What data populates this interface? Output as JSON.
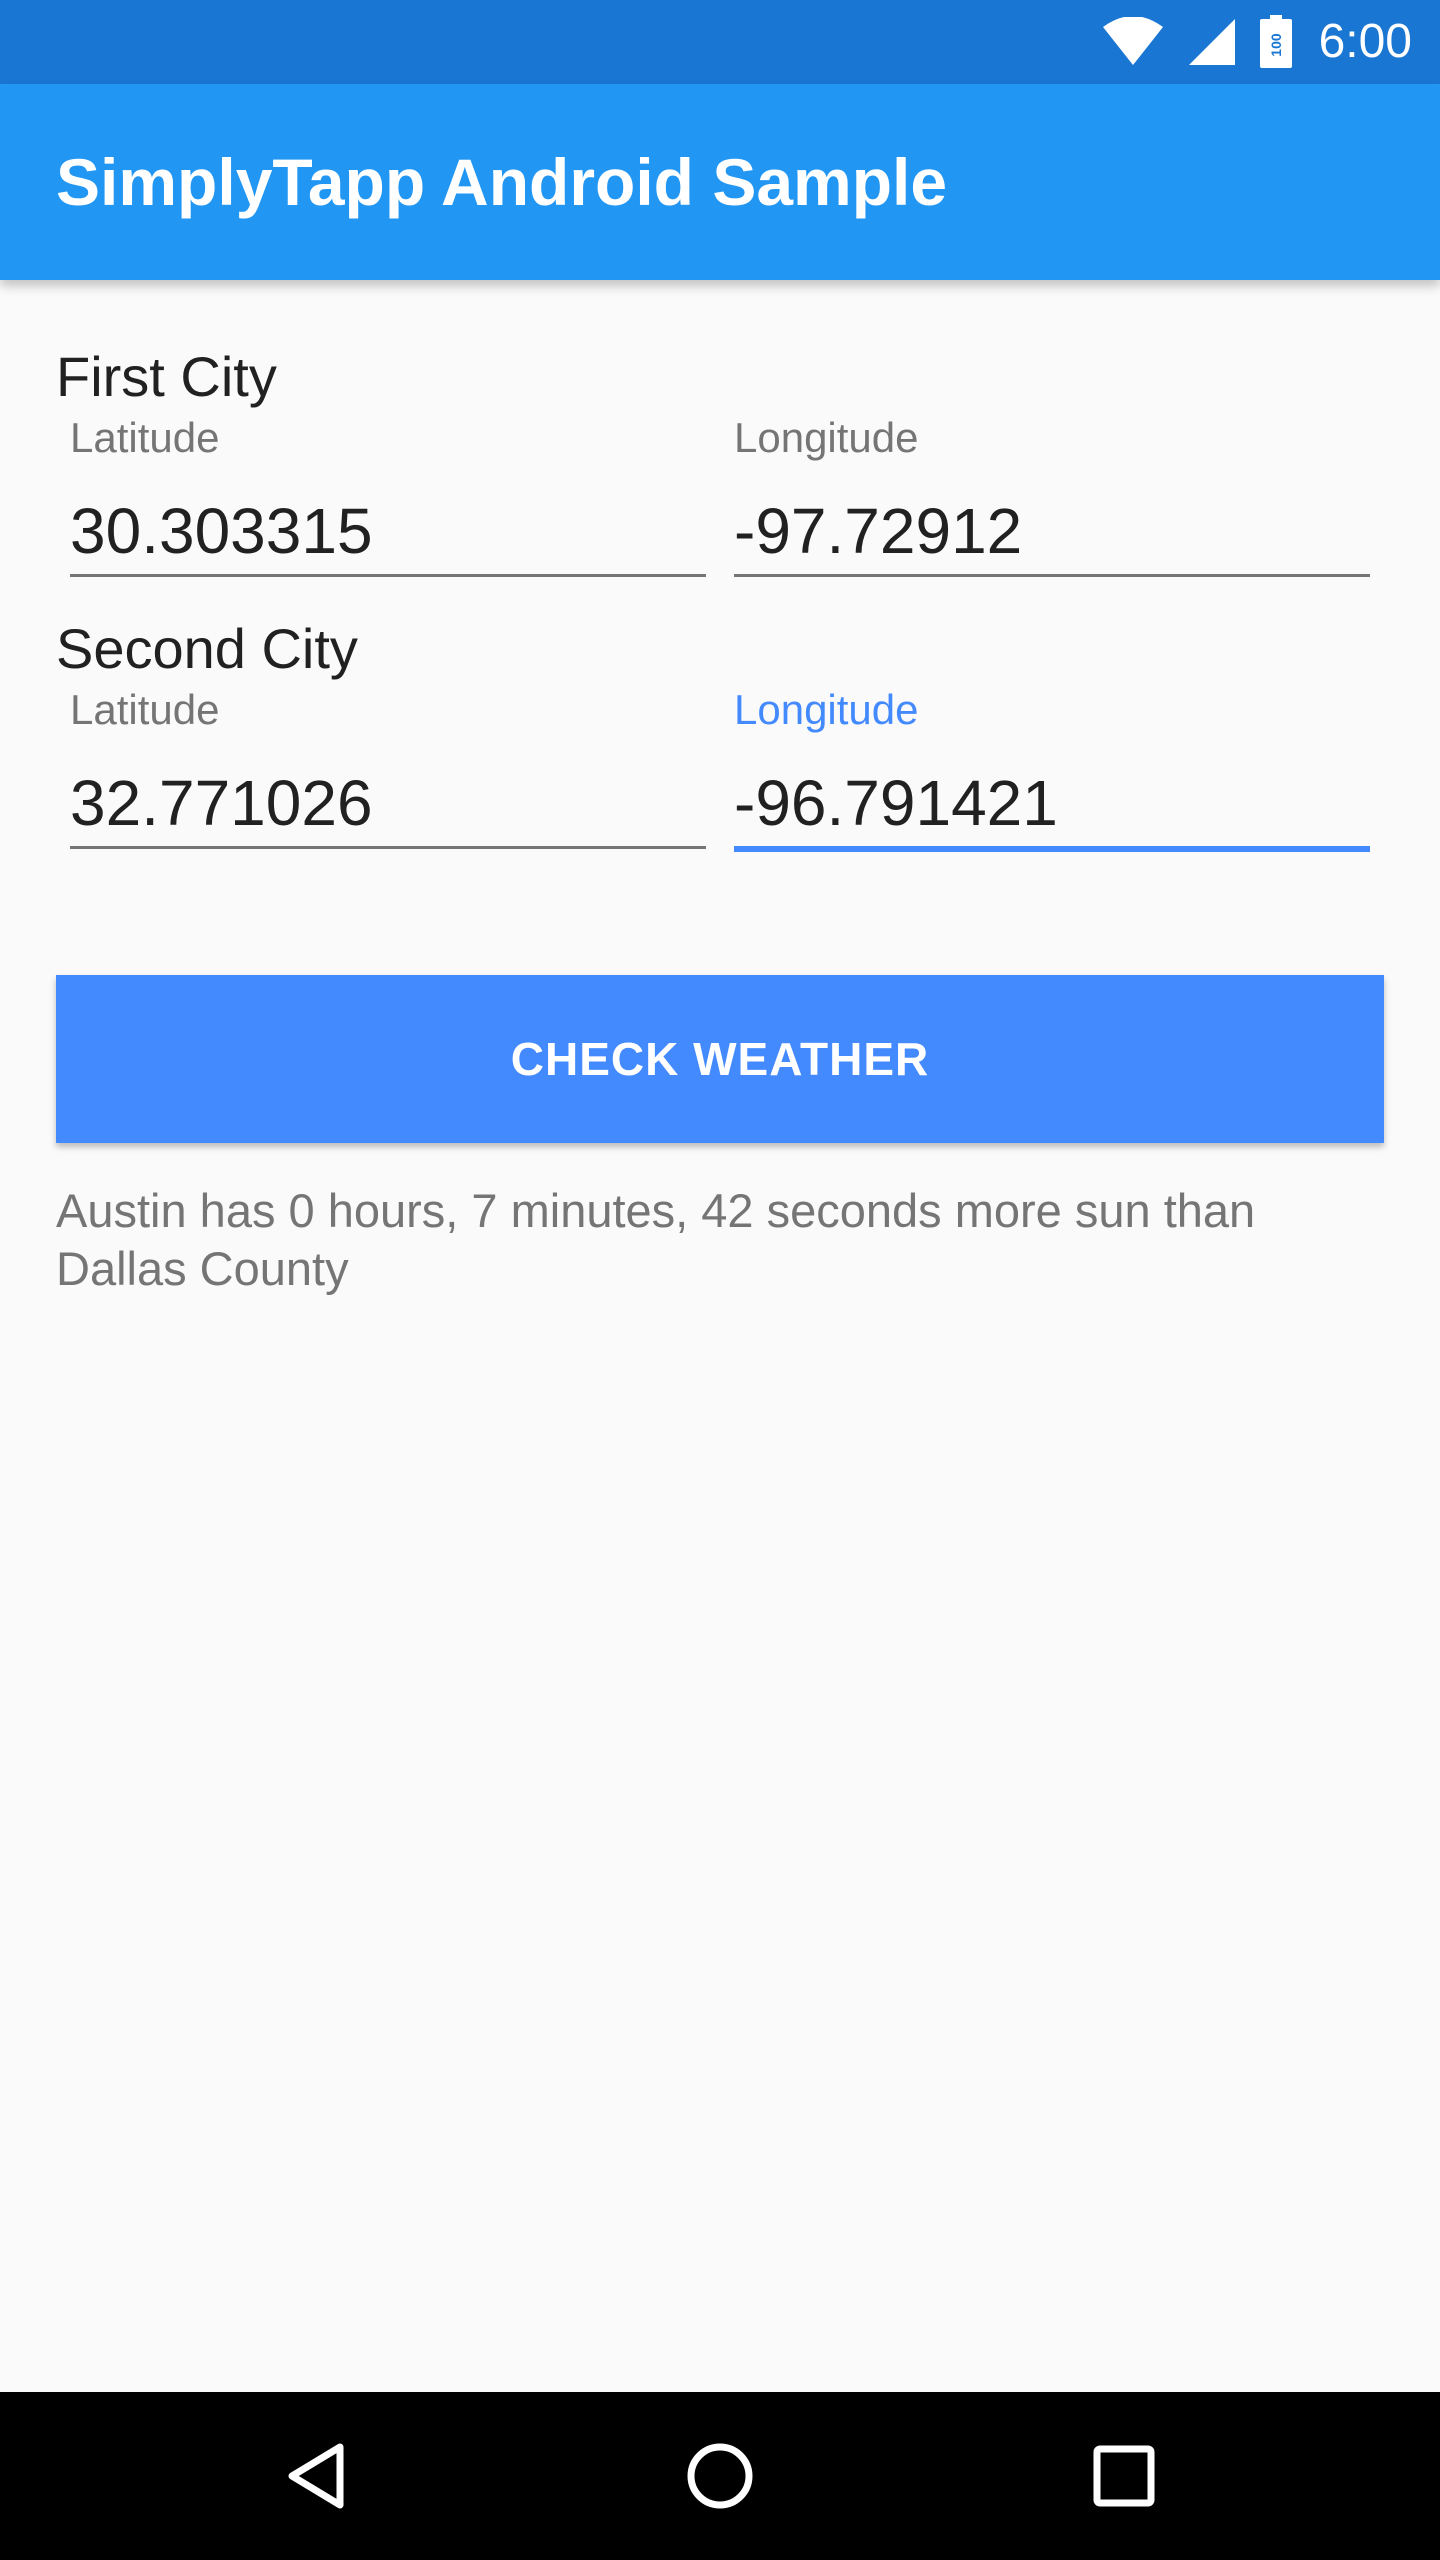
{
  "status_bar": {
    "time": "6:00",
    "battery_level": "100",
    "icons": [
      "wifi-icon",
      "cell-signal-icon",
      "battery-icon"
    ]
  },
  "app_bar": {
    "title": "SimplyTapp Android Sample",
    "color": "#2196F3"
  },
  "first_city": {
    "title": "First City",
    "latitude": {
      "label": "Latitude",
      "value": "30.303315"
    },
    "longitude": {
      "label": "Longitude",
      "value": "-97.72912"
    }
  },
  "second_city": {
    "title": "Second City",
    "latitude": {
      "label": "Latitude",
      "value": "32.771026"
    },
    "longitude": {
      "label": "Longitude",
      "value": "-96.791421",
      "focused": true
    }
  },
  "actions": {
    "check_weather_label": "CHECK WEATHER"
  },
  "result": {
    "text": "Austin has 0 hours, 7 minutes, 42 seconds more sun than Dallas County"
  },
  "nav_bar": {
    "icons": [
      "back-icon",
      "home-icon",
      "recents-icon"
    ]
  },
  "colors": {
    "status_bar": "#1976D2",
    "accent": "#448AFF",
    "text_primary": "#212121",
    "text_secondary": "#757575"
  }
}
